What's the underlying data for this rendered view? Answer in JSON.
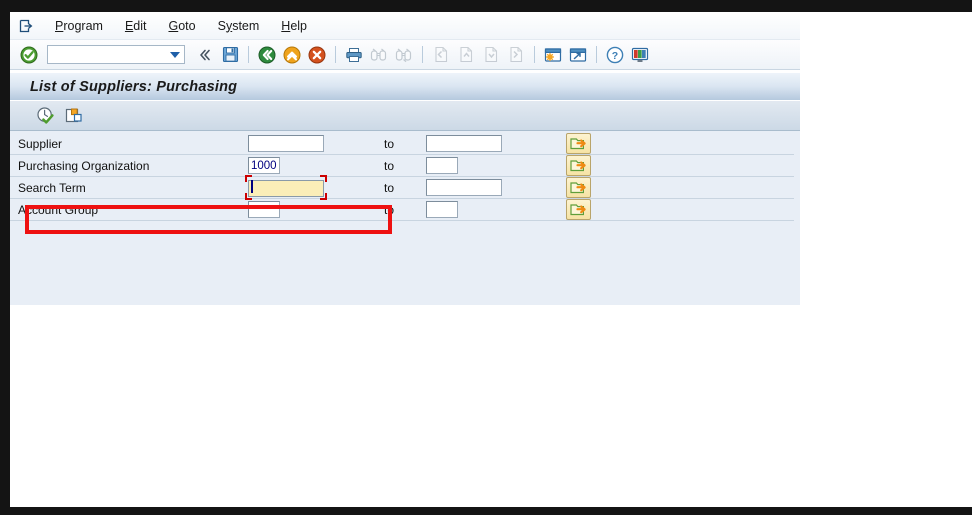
{
  "window": {
    "title": "List of Suppliers: Purchasing"
  },
  "menu": {
    "session_icon": "new-session-icon",
    "items": [
      {
        "label": "Program",
        "accel": "P"
      },
      {
        "label": "Edit",
        "accel": "E"
      },
      {
        "label": "Goto",
        "accel": "G"
      },
      {
        "label": "System",
        "accel": "y"
      },
      {
        "label": "Help",
        "accel": "H"
      }
    ]
  },
  "toolbar": {
    "enter_icon": "green-check-enter-icon",
    "command_field": {
      "value": "",
      "placeholder": ""
    },
    "dropdown_icon": "chevron-down-icon",
    "items": [
      {
        "name": "collapse-toolbar-icon",
        "label": "«",
        "enabled": true
      },
      {
        "name": "save-icon",
        "label": "Save",
        "enabled": true
      },
      {
        "name": "back-icon",
        "label": "Back",
        "enabled": true
      },
      {
        "name": "exit-icon",
        "label": "Exit",
        "enabled": true
      },
      {
        "name": "cancel-icon",
        "label": "Cancel",
        "enabled": true
      },
      {
        "name": "print-icon",
        "label": "Print",
        "enabled": true
      },
      {
        "name": "find-icon",
        "label": "Find",
        "enabled": false
      },
      {
        "name": "find-next-icon",
        "label": "Find Next",
        "enabled": false
      },
      {
        "name": "first-page-icon",
        "label": "First Page",
        "enabled": false
      },
      {
        "name": "previous-page-icon",
        "label": "Previous Page",
        "enabled": false
      },
      {
        "name": "next-page-icon",
        "label": "Next Page",
        "enabled": false
      },
      {
        "name": "last-page-icon",
        "label": "Last Page",
        "enabled": false
      },
      {
        "name": "create-session-icon",
        "label": "Create New Session",
        "enabled": true
      },
      {
        "name": "create-shortcut-icon",
        "label": "Create Shortcut",
        "enabled": true
      },
      {
        "name": "help-icon",
        "label": "Help",
        "enabled": true
      },
      {
        "name": "customize-layout-icon",
        "label": "Customize Local Layout",
        "enabled": true
      }
    ]
  },
  "app_toolbar": {
    "items": [
      {
        "name": "execute-icon",
        "label": "Execute"
      },
      {
        "name": "multiple-selection-icon",
        "label": "Multiple Selection"
      }
    ]
  },
  "selection_screen": {
    "to_label": "to",
    "multi_select_icon": "multi-selection-arrow-icon",
    "rows": [
      {
        "label": "Supplier",
        "from_value": "",
        "to_value": "",
        "from_size": "wide",
        "to_size": "wide",
        "focused": false
      },
      {
        "label": "Purchasing Organization",
        "from_value": "1000",
        "to_value": "",
        "from_size": "narrow",
        "to_size": "narrow",
        "focused": false
      },
      {
        "label": "Search Term",
        "from_value": "",
        "to_value": "",
        "from_size": "wide",
        "to_size": "wide",
        "focused": true
      },
      {
        "label": "Account Group",
        "from_value": "",
        "to_value": "",
        "from_size": "narrow",
        "to_size": "narrow",
        "focused": false
      }
    ]
  },
  "annotation": {
    "color": "#ee1111",
    "target": "Search Term"
  },
  "colors": {
    "accent": "#1f5fa8",
    "title_gradient_top": "#eef4fa",
    "title_gradient_bottom": "#b5c9de",
    "body_background": "#e8eef6",
    "focus_field": "#fbeeb8",
    "input_text": "#000080",
    "annotation_red": "#ee1111"
  }
}
